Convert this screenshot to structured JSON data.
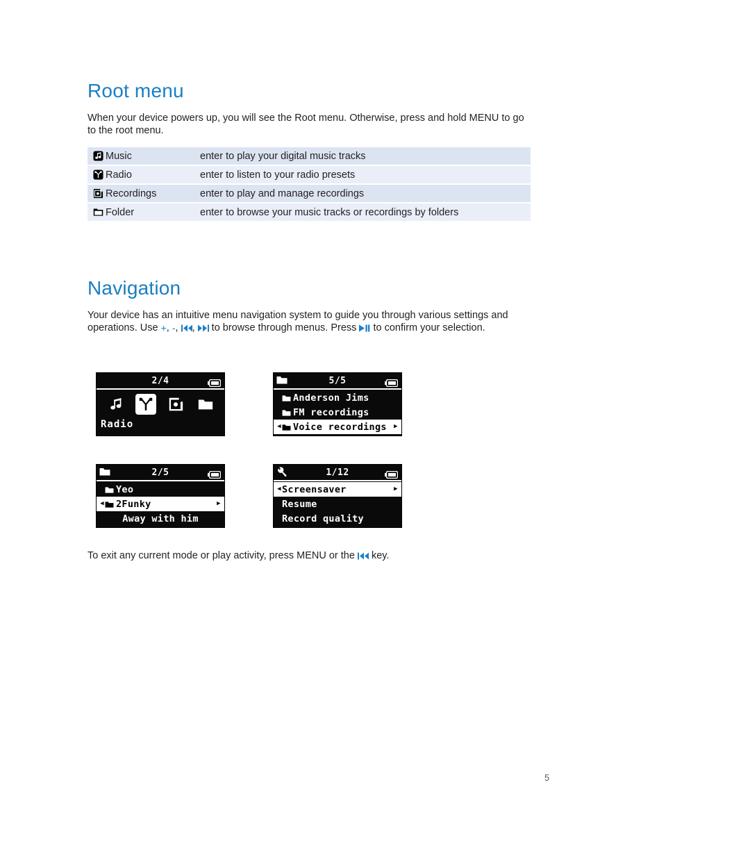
{
  "document": {
    "page_number": "5",
    "accent_color": "#1a7fc1",
    "table_row_color": "#dce4f2",
    "table_row_alt_color": "#e9eef8"
  },
  "root_menu_section": {
    "heading": "Root menu",
    "intro": "When your device powers up, you will see the Root menu. Otherwise, press and hold MENU to go to the root menu.",
    "rows": [
      {
        "icon": "music-note-icon",
        "name": "Music",
        "description": "enter to play your digital music tracks"
      },
      {
        "icon": "radio-antenna-icon",
        "name": "Radio",
        "description": "enter to listen to your radio presets"
      },
      {
        "icon": "recordings-mic-icon",
        "name": "Recordings",
        "description": "enter to play and manage recordings"
      },
      {
        "icon": "folder-icon",
        "name": "Folder",
        "description": "enter to browse your music tracks or recordings by folders"
      }
    ]
  },
  "navigation_section": {
    "heading": "Navigation",
    "paragraph_part1": "Your device has an intuitive menu navigation system to guide you through various settings and operations.  Use ",
    "icon_plus": "+",
    "comma1": ", ",
    "icon_minus": "-",
    "comma2": ", ",
    "icon_prev": "prev-track-icon",
    "comma3": ", ",
    "icon_next": "next-track-icon",
    "paragraph_part2": " to browse through menus. Press ",
    "icon_playpause": "play-pause-icon",
    "paragraph_part3": " to confirm your selection.",
    "exit_part1": "To exit any current mode or play activity, press MENU or the ",
    "exit_icon": "prev-track-icon",
    "exit_part2": " key."
  },
  "lcd_screens": [
    {
      "id": "root-menu-screen",
      "title": "2/4",
      "title_icon": "none",
      "battery_icon": "battery-full-icon",
      "type": "icon-grid",
      "icons": [
        {
          "name": "music-note-icon",
          "selected": false
        },
        {
          "name": "radio-antenna-icon",
          "selected": true
        },
        {
          "name": "recordings-mic-icon",
          "selected": false
        },
        {
          "name": "folder-icon",
          "selected": false
        }
      ],
      "label": "Radio"
    },
    {
      "id": "folder-list-screen",
      "title": "5/5",
      "title_icon": "folder-icon",
      "battery_icon": "battery-full-icon",
      "type": "list",
      "items": [
        {
          "text": "Anderson Jims",
          "folder": true,
          "selected": false
        },
        {
          "text": "FM recordings",
          "folder": true,
          "selected": false
        },
        {
          "text": "Voice recordings",
          "folder": true,
          "selected": true
        }
      ]
    },
    {
      "id": "album-list-screen",
      "title": "2/5",
      "title_icon": "folder-icon",
      "battery_icon": "battery-full-icon",
      "type": "list",
      "items": [
        {
          "text": "Yeo",
          "folder": true,
          "selected": false
        },
        {
          "text": "2Funky",
          "folder": true,
          "selected": true
        },
        {
          "text": "Away with him",
          "folder": false,
          "selected": false,
          "centered": true
        }
      ]
    },
    {
      "id": "settings-list-screen",
      "title": "1/12",
      "title_icon": "wrench-icon",
      "battery_icon": "battery-full-icon",
      "type": "list",
      "items": [
        {
          "text": "Screensaver",
          "folder": false,
          "selected": true
        },
        {
          "text": "Resume",
          "folder": false,
          "selected": false
        },
        {
          "text": "Record quality",
          "folder": false,
          "selected": false
        }
      ]
    }
  ]
}
